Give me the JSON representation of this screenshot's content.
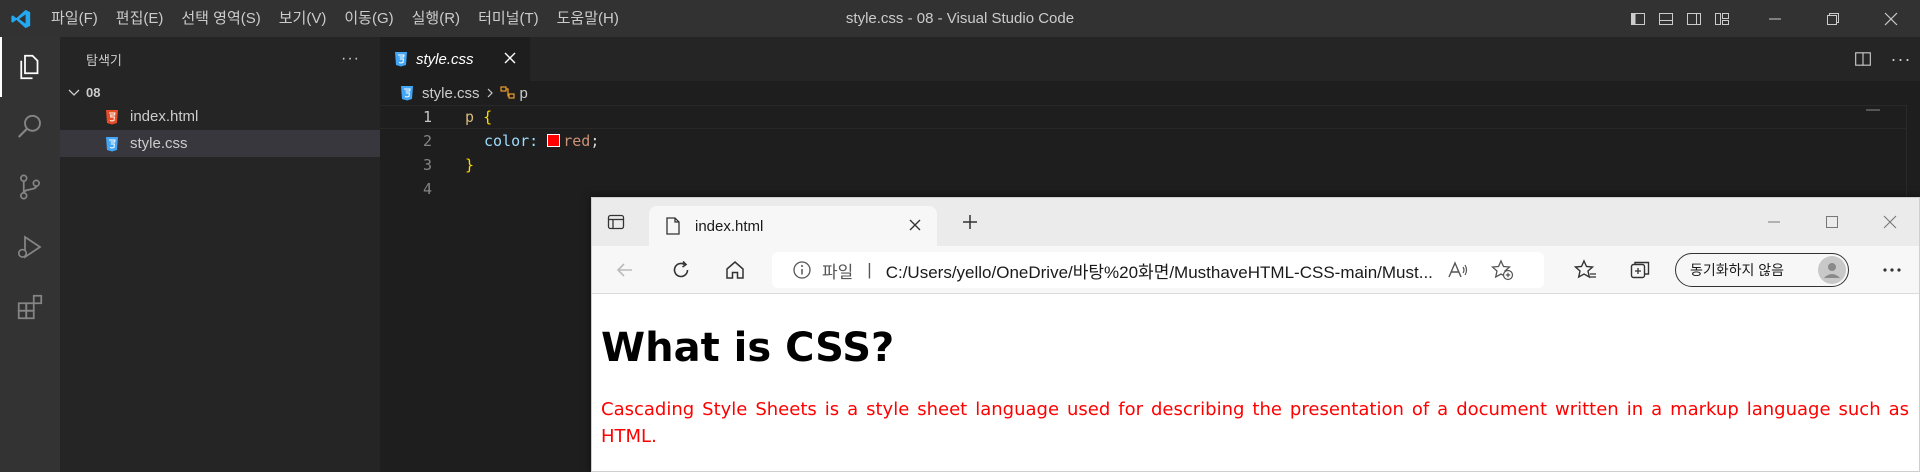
{
  "titlebar": {
    "title": "style.css - 08 - Visual Studio Code",
    "menu": [
      "파일(F)",
      "편집(E)",
      "선택 영역(S)",
      "보기(V)",
      "이동(G)",
      "실행(R)",
      "터미널(T)",
      "도움말(H)"
    ]
  },
  "sidebar": {
    "title": "탐색기",
    "more": "···",
    "folder": "08",
    "files": [
      {
        "name": "index.html",
        "icon": "html-file-icon",
        "color": "#e44d26"
      },
      {
        "name": "style.css",
        "icon": "css-file-icon",
        "color": "#42a5f5"
      }
    ]
  },
  "editor": {
    "tab_label": "style.css",
    "breadcrumb": {
      "file": "style.css",
      "symbol": "p"
    },
    "lines": [
      {
        "n": "1",
        "selector": "p",
        "brace": "{"
      },
      {
        "n": "2",
        "property": "color:",
        "value": "red",
        "punc": ";",
        "swatch_color": "#ff0000"
      },
      {
        "n": "3",
        "brace": "}"
      },
      {
        "n": "4"
      }
    ]
  },
  "browser": {
    "tab_title": "index.html",
    "address_prefix": "파일",
    "address": "C:/Users/yello/OneDrive/바탕%20화면/MusthaveHTML-CSS-main/Must...",
    "sync_label": "동기화하지 않음",
    "page": {
      "heading": "What is CSS?",
      "paragraph": "Cascading Style Sheets is a style sheet language used for describing the presentation of a document written in a markup language such as HTML.",
      "paragraph_color": "#ff0000"
    }
  },
  "colors": {
    "vscode_accent": "#0078d4",
    "css_blue": "#42a5f5",
    "html_orange": "#e44d26"
  }
}
